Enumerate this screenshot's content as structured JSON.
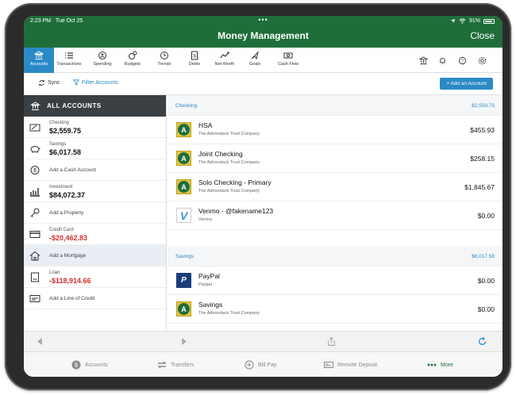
{
  "status": {
    "time": "2:23 PM",
    "date": "Tue Oct 25",
    "battery": "91%"
  },
  "header": {
    "title": "Money Management",
    "close_label": "Close"
  },
  "tabs": [
    {
      "label": "Accounts",
      "icon": "bank-icon",
      "active": true
    },
    {
      "label": "Transactions",
      "icon": "list-icon"
    },
    {
      "label": "Spending",
      "icon": "spending-icon"
    },
    {
      "label": "Budgets",
      "icon": "budgets-icon"
    },
    {
      "label": "Trends",
      "icon": "clock-icon"
    },
    {
      "label": "Debts",
      "icon": "debts-icon"
    },
    {
      "label": "Net Worth",
      "icon": "networth-icon"
    },
    {
      "label": "Goals",
      "icon": "goals-icon"
    },
    {
      "label": "Cash Flow",
      "icon": "cashflow-icon"
    }
  ],
  "actions": {
    "sync_label": "Sync",
    "filter_label": "Filter Accounts",
    "add_label": "+ Add an Account"
  },
  "sidebar": {
    "header": "ALL ACCOUNTS",
    "items": [
      {
        "category": "Checking",
        "amount": "$2,559.75",
        "icon": "checkbook-icon"
      },
      {
        "category": "Savings",
        "amount": "$6,017.58",
        "icon": "piggy-bank-icon"
      },
      {
        "label": "Add a Cash Account",
        "icon": "dollar-coin-icon"
      },
      {
        "category": "Investment",
        "amount": "$84,072.37",
        "icon": "chart-bars-icon"
      },
      {
        "label": "Add a Property",
        "icon": "key-icon"
      },
      {
        "category": "Credit Card",
        "amount": "-$20,462.83",
        "icon": "credit-card-icon",
        "negative": true
      },
      {
        "label": "Add a Mortgage",
        "icon": "house-icon",
        "selected": true
      },
      {
        "category": "Loan",
        "amount": "-$118,914.66",
        "icon": "loan-document-icon",
        "negative": true
      },
      {
        "label": "Add a Line of Credit",
        "icon": "line-of-credit-icon"
      }
    ]
  },
  "sections": [
    {
      "name": "Checking",
      "total": "$2,559.75",
      "accounts": [
        {
          "name": "HSA",
          "institution": "The Adirondack Trust Company",
          "balance": "$455.93",
          "logo": "adirondack"
        },
        {
          "name": "Joint Checking",
          "institution": "The Adirondack Trust Company",
          "balance": "$258.15",
          "logo": "adirondack"
        },
        {
          "name": "Solo Checking - Primary",
          "institution": "The Adirondack Trust Company",
          "balance": "$1,845.67",
          "logo": "adirondack"
        },
        {
          "name": "Venmo - @fakename123",
          "institution": "Venmo",
          "balance": "$0.00",
          "logo": "venmo"
        }
      ]
    },
    {
      "name": "Savings",
      "total": "$6,017.58",
      "accounts": [
        {
          "name": "PayPal",
          "institution": "Paypal",
          "balance": "$0.00",
          "logo": "paypal"
        },
        {
          "name": "Savings",
          "institution": "The Adirondack Trust Company",
          "balance": "$0.00",
          "logo": "adirondack"
        }
      ]
    }
  ],
  "logo_letters": {
    "adirondack": "A",
    "venmo": "V",
    "paypal": "P"
  },
  "bottom_nav": [
    {
      "label": "Accounts",
      "icon": "dollar-icon"
    },
    {
      "label": "Transfers",
      "icon": "transfer-arrows-icon"
    },
    {
      "label": "Bill Pay",
      "icon": "bill-pay-icon"
    },
    {
      "label": "Remote Deposit",
      "icon": "remote-deposit-icon"
    },
    {
      "label": "More",
      "icon": "more-dots-icon",
      "active": true
    }
  ],
  "colors": {
    "brand_green": "#1f6e3a",
    "accent_blue": "#2b8ac6",
    "negative_red": "#d0312d"
  }
}
